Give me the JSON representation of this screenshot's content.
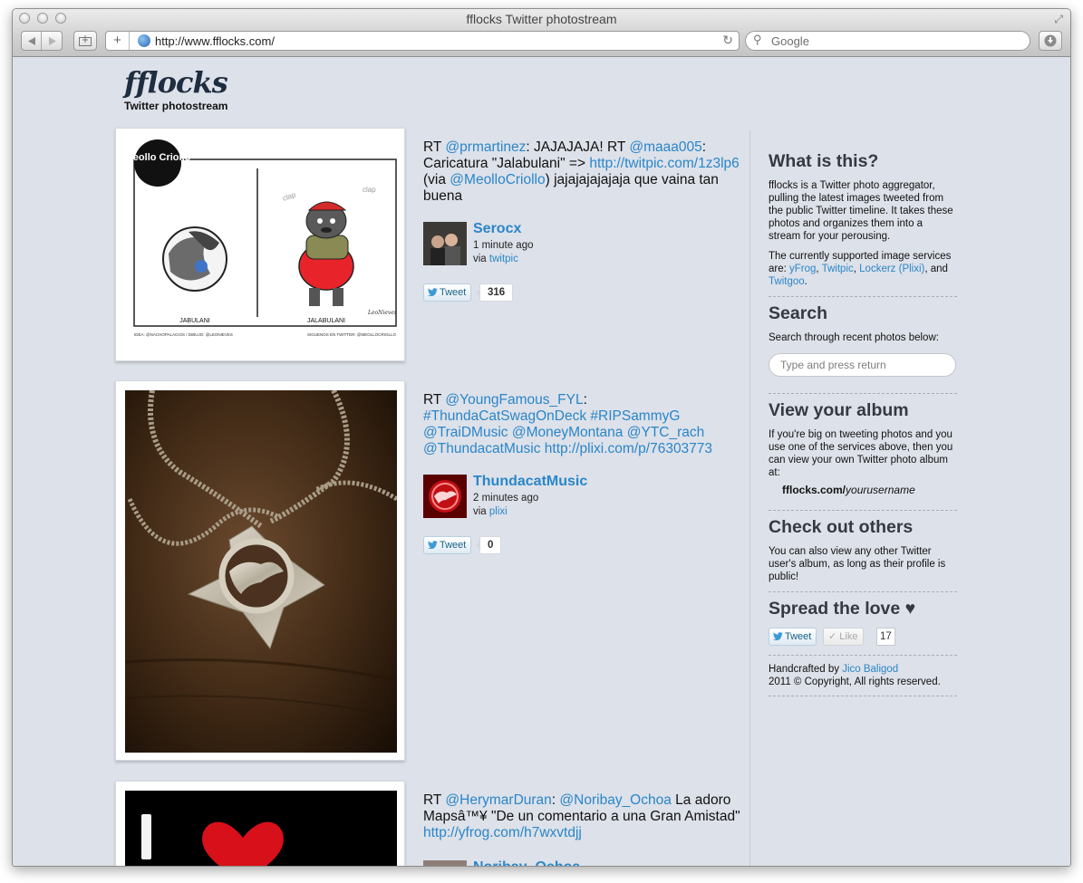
{
  "browser": {
    "window_title": "fflocks Twitter photostream",
    "url": "http://www.fflocks.com/",
    "search_placeholder": "Google"
  },
  "site": {
    "logo": "fflocks",
    "tagline": "Twitter photostream"
  },
  "posts": [
    {
      "text_parts": [
        {
          "t": "RT "
        },
        {
          "t": "@prmartinez",
          "link": true
        },
        {
          "t": ": JAJAJAJA! RT "
        },
        {
          "t": "@maaa005",
          "link": true
        },
        {
          "t": ": Caricatura \"Jalabulani\" => "
        },
        {
          "t": "http://twitpic.com/1z3lp6",
          "link": true
        },
        {
          "t": " (via "
        },
        {
          "t": "@MeolloCriollo",
          "link": true
        },
        {
          "t": ") jajajajajajaja que vaina tan buena"
        }
      ],
      "author": "Serocx",
      "time": "1 minute ago",
      "via_label": "via ",
      "via_service": "twitpic",
      "tweet_label": "Tweet",
      "tweet_count": "316",
      "photo": {
        "stamp": "Meollo Criollo",
        "left_caption": "JABULANI",
        "right_caption": "JALABULANI",
        "clap": "clap",
        "signature": "LeoNieves",
        "footer_left": "IDEA: @NACHOPALACIOS / DIBUJO: @LEONIEVES",
        "footer_right": "SIGUENOS EN TWITTER: @MEOLLOCRIOLLO"
      }
    },
    {
      "text_parts": [
        {
          "t": "RT "
        },
        {
          "t": "@YoungFamous_FYL",
          "link": true
        },
        {
          "t": ": "
        },
        {
          "t": "#ThundaCatSwagOnDeck",
          "link": true
        },
        {
          "t": " "
        },
        {
          "t": "#RIPSammyG",
          "link": true
        },
        {
          "t": " "
        },
        {
          "t": "@TraiDMusic",
          "link": true
        },
        {
          "t": " "
        },
        {
          "t": "@MoneyMontana",
          "link": true
        },
        {
          "t": " "
        },
        {
          "t": "@YTC_rach",
          "link": true
        },
        {
          "t": " "
        },
        {
          "t": "@ThundacatMusic",
          "link": true
        },
        {
          "t": " "
        },
        {
          "t": "http://plixi.com/p/76303773",
          "link": true
        }
      ],
      "author": "ThundacatMusic",
      "time": "2 minutes ago",
      "via_label": "via ",
      "via_service": "plixi",
      "tweet_label": "Tweet",
      "tweet_count": "0"
    },
    {
      "text_parts": [
        {
          "t": "RT "
        },
        {
          "t": "@HerymarDuran",
          "link": true
        },
        {
          "t": ": "
        },
        {
          "t": "@Noribay_Ochoa",
          "link": true
        },
        {
          "t": " La adoro Mapsâ™¥ \"De un comentario a una Gran Amistad\" "
        },
        {
          "t": "http://yfrog.com/h7wxvtdjj",
          "link": true
        }
      ],
      "author": "Noribay_Ochoa"
    }
  ],
  "sidebar": {
    "what": {
      "title": "What is this?",
      "p1": "fflocks is a Twitter photo aggregator, pulling the latest images tweeted from the public Twitter timeline. It takes these photos and organizes them into a stream for your perousing.",
      "p2_prefix": "The currently supported image services are: ",
      "services": [
        "yFrog",
        "Twitpic",
        "Lockerz (Plixi)",
        "Twitgoo"
      ],
      "sep1": ", ",
      "sep2": ", and ",
      "end": "."
    },
    "search": {
      "title": "Search",
      "desc": "Search through recent photos below:",
      "placeholder": "Type and press return"
    },
    "album": {
      "title": "View your album",
      "desc": "If you're big on tweeting photos and you use one of the services above, then you can view your own Twitter photo album at:",
      "url_bold": "fflocks.com/",
      "url_italic": "yourusername"
    },
    "others": {
      "title": "Check out others",
      "desc": "You can also view any other Twitter user's album, as long as their profile is public!"
    },
    "love": {
      "title": "Spread the love ♥",
      "tweet_label": "Tweet",
      "like_label": "Like",
      "like_count": "17"
    },
    "footer": {
      "prefix": "Handcrafted by ",
      "author": "Jico Baligod",
      "copyright": "2011 © Copyright, All rights reserved."
    }
  },
  "colors": {
    "link": "#2a86c9",
    "page_background": "#dde1e9",
    "heading": "#353a42"
  }
}
